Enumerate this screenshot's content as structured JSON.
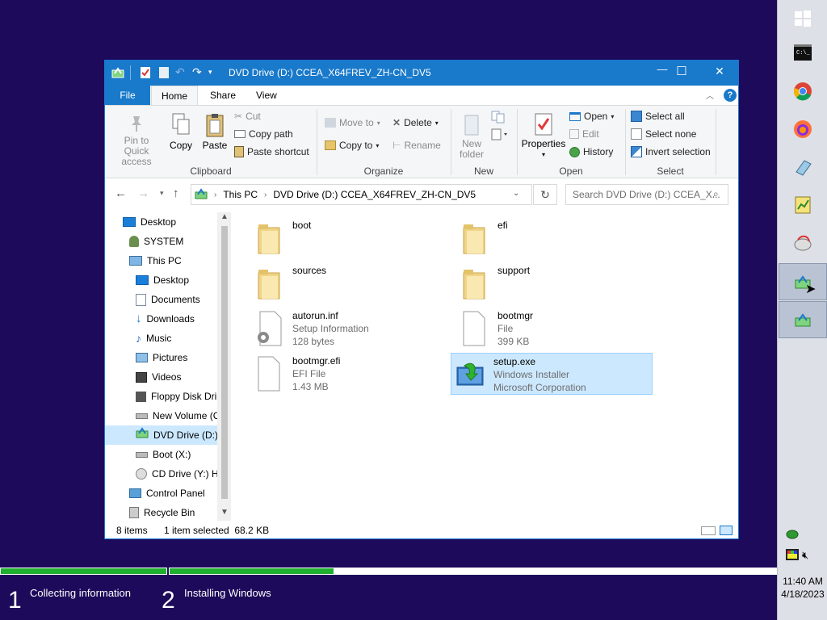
{
  "window": {
    "title": "DVD Drive (D:) CCEA_X64FREV_ZH-CN_DV5",
    "minimize": "—",
    "maximize": "☐",
    "close": "✕",
    "help": "?"
  },
  "ribbon_tabs": [
    "File",
    "Home",
    "Share",
    "View"
  ],
  "ribbon": {
    "clipboard": {
      "label": "Clipboard",
      "pin": "Pin to Quick access",
      "copy": "Copy",
      "paste": "Paste",
      "cut": "Cut",
      "copy_path": "Copy path",
      "paste_shortcut": "Paste shortcut"
    },
    "organize": {
      "label": "Organize",
      "move_to": "Move to",
      "copy_to": "Copy to",
      "delete": "Delete",
      "rename": "Rename"
    },
    "new": {
      "label": "New",
      "new_folder": "New folder"
    },
    "open": {
      "label": "Open",
      "properties": "Properties",
      "open": "Open",
      "edit": "Edit",
      "history": "History"
    },
    "select": {
      "label": "Select",
      "select_all": "Select all",
      "select_none": "Select none",
      "invert": "Invert selection"
    }
  },
  "address": {
    "crumbs": [
      "This PC",
      "DVD Drive (D:) CCEA_X64FREV_ZH-CN_DV5"
    ],
    "search_placeholder": "Search DVD Drive (D:) CCEA_X..."
  },
  "nav": [
    {
      "label": "Desktop",
      "icon": "desktop-icon"
    },
    {
      "label": "SYSTEM",
      "icon": "user-icon"
    },
    {
      "label": "This PC",
      "icon": "computer-icon"
    },
    {
      "label": "Desktop",
      "icon": "desktop-icon"
    },
    {
      "label": "Documents",
      "icon": "documents-icon"
    },
    {
      "label": "Downloads",
      "icon": "downloads-icon"
    },
    {
      "label": "Music",
      "icon": "music-icon"
    },
    {
      "label": "Pictures",
      "icon": "pictures-icon"
    },
    {
      "label": "Videos",
      "icon": "videos-icon"
    },
    {
      "label": "Floppy Disk Dri",
      "icon": "floppy-icon"
    },
    {
      "label": "New Volume (C",
      "icon": "drive-icon"
    },
    {
      "label": "DVD Drive (D:)",
      "icon": "dvd-drive-icon"
    },
    {
      "label": "Boot (X:)",
      "icon": "drive-icon"
    },
    {
      "label": "CD Drive (Y:) H",
      "icon": "cd-drive-icon"
    },
    {
      "label": "Control Panel",
      "icon": "control-panel-icon"
    },
    {
      "label": "Recycle Bin",
      "icon": "recycle-bin-icon"
    }
  ],
  "files": [
    {
      "name": "boot",
      "line2": "",
      "line3": "",
      "icon": "folder-icon"
    },
    {
      "name": "efi",
      "line2": "",
      "line3": "",
      "icon": "folder-icon"
    },
    {
      "name": "sources",
      "line2": "",
      "line3": "",
      "icon": "folder-icon"
    },
    {
      "name": "support",
      "line2": "",
      "line3": "",
      "icon": "folder-icon"
    },
    {
      "name": "autorun.inf",
      "line2": "Setup Information",
      "line3": "128 bytes",
      "icon": "settings-file-icon"
    },
    {
      "name": "bootmgr",
      "line2": "File",
      "line3": "399 KB",
      "icon": "file-icon"
    },
    {
      "name": "bootmgr.efi",
      "line2": "EFI File",
      "line3": "1.43 MB",
      "icon": "file-icon"
    },
    {
      "name": "setup.exe",
      "line2": "Windows Installer",
      "line3": "Microsoft Corporation",
      "icon": "installer-icon"
    }
  ],
  "status": {
    "count": "8 items",
    "selected": "1 item selected  68.2 KB"
  },
  "setup": {
    "step1_num": "1",
    "step1": "Collecting information",
    "step2_num": "2",
    "step2": "Installing Windows",
    "step1_progress": 1.0,
    "step2_progress": 0.27
  },
  "clock": {
    "time": "11:40 AM",
    "date": "4/18/2023"
  },
  "colors": {
    "accent": "#1979ca",
    "selection": "#cce8ff",
    "progress": "#20b030",
    "background": "#1e0a5a"
  }
}
